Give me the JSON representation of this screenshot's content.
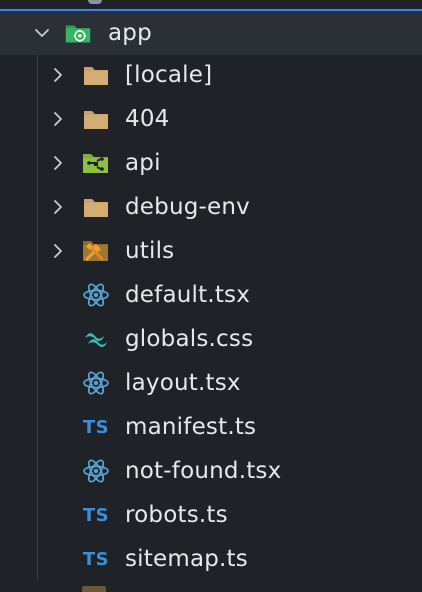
{
  "explorer": {
    "root": {
      "label": "app",
      "icon": "app-folder-icon",
      "expanded": true
    },
    "items": [
      {
        "label": "[locale]",
        "kind": "folder",
        "icon": "folder-icon"
      },
      {
        "label": "404",
        "kind": "folder",
        "icon": "folder-icon"
      },
      {
        "label": "api",
        "kind": "folder",
        "icon": "api-folder-icon"
      },
      {
        "label": "debug-env",
        "kind": "folder",
        "icon": "folder-icon"
      },
      {
        "label": "utils",
        "kind": "folder",
        "icon": "utils-folder-icon"
      },
      {
        "label": "default.tsx",
        "kind": "file",
        "icon": "react-icon"
      },
      {
        "label": "globals.css",
        "kind": "file",
        "icon": "tailwind-icon"
      },
      {
        "label": "layout.tsx",
        "kind": "file",
        "icon": "react-icon"
      },
      {
        "label": "manifest.ts",
        "kind": "file",
        "icon": "typescript-icon",
        "icon_text": "TS"
      },
      {
        "label": "not-found.tsx",
        "kind": "file",
        "icon": "react-icon"
      },
      {
        "label": "robots.ts",
        "kind": "file",
        "icon": "typescript-icon",
        "icon_text": "TS"
      },
      {
        "label": "sitemap.ts",
        "kind": "file",
        "icon": "typescript-icon",
        "icon_text": "TS"
      }
    ]
  },
  "colors": {
    "background": "#1f2227",
    "selected_background": "#2b2f36",
    "selection_accent": "#3b82f6",
    "text": "#e6e8eb",
    "folder": "#c9a26b",
    "react": "#58a6d6",
    "typescript": "#3b8fd8",
    "tailwind": "#3fb9b3",
    "app_folder": "#2e9e57"
  }
}
